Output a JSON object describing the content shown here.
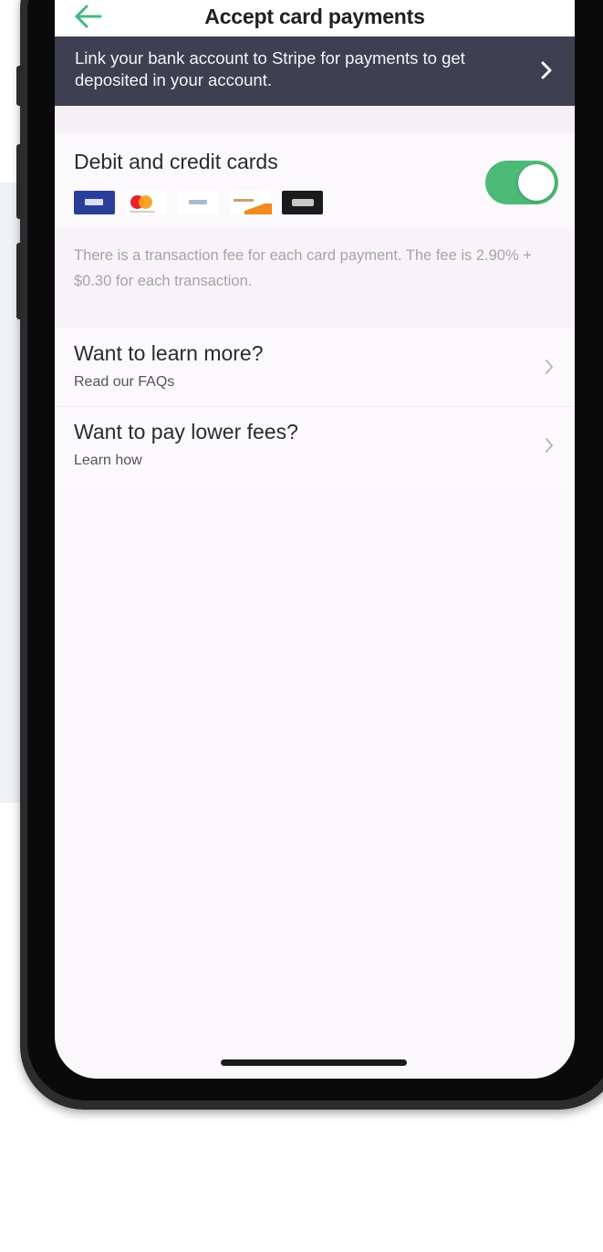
{
  "header": {
    "title": "Accept card payments"
  },
  "banner": {
    "text": "Link your bank account to Stripe for payments to get deposited in your account."
  },
  "cards": {
    "title": "Debit and credit cards",
    "toggle_on": true,
    "logos": [
      "visa-logo",
      "mastercard-logo",
      "amex-logo",
      "discover-logo",
      "apple-pay-logo"
    ],
    "fee_text": "There is a transaction fee for each card payment. The fee is 2.90% + $0.30 for each transaction."
  },
  "rows": [
    {
      "title": "Want to learn more?",
      "subtitle": "Read our FAQs"
    },
    {
      "title": "Want to pay lower fees?",
      "subtitle": "Learn how"
    }
  ],
  "colors": {
    "accent_green": "#4cb976",
    "banner_bg": "#3f3f52",
    "back_arrow": "#3dbb7f"
  }
}
